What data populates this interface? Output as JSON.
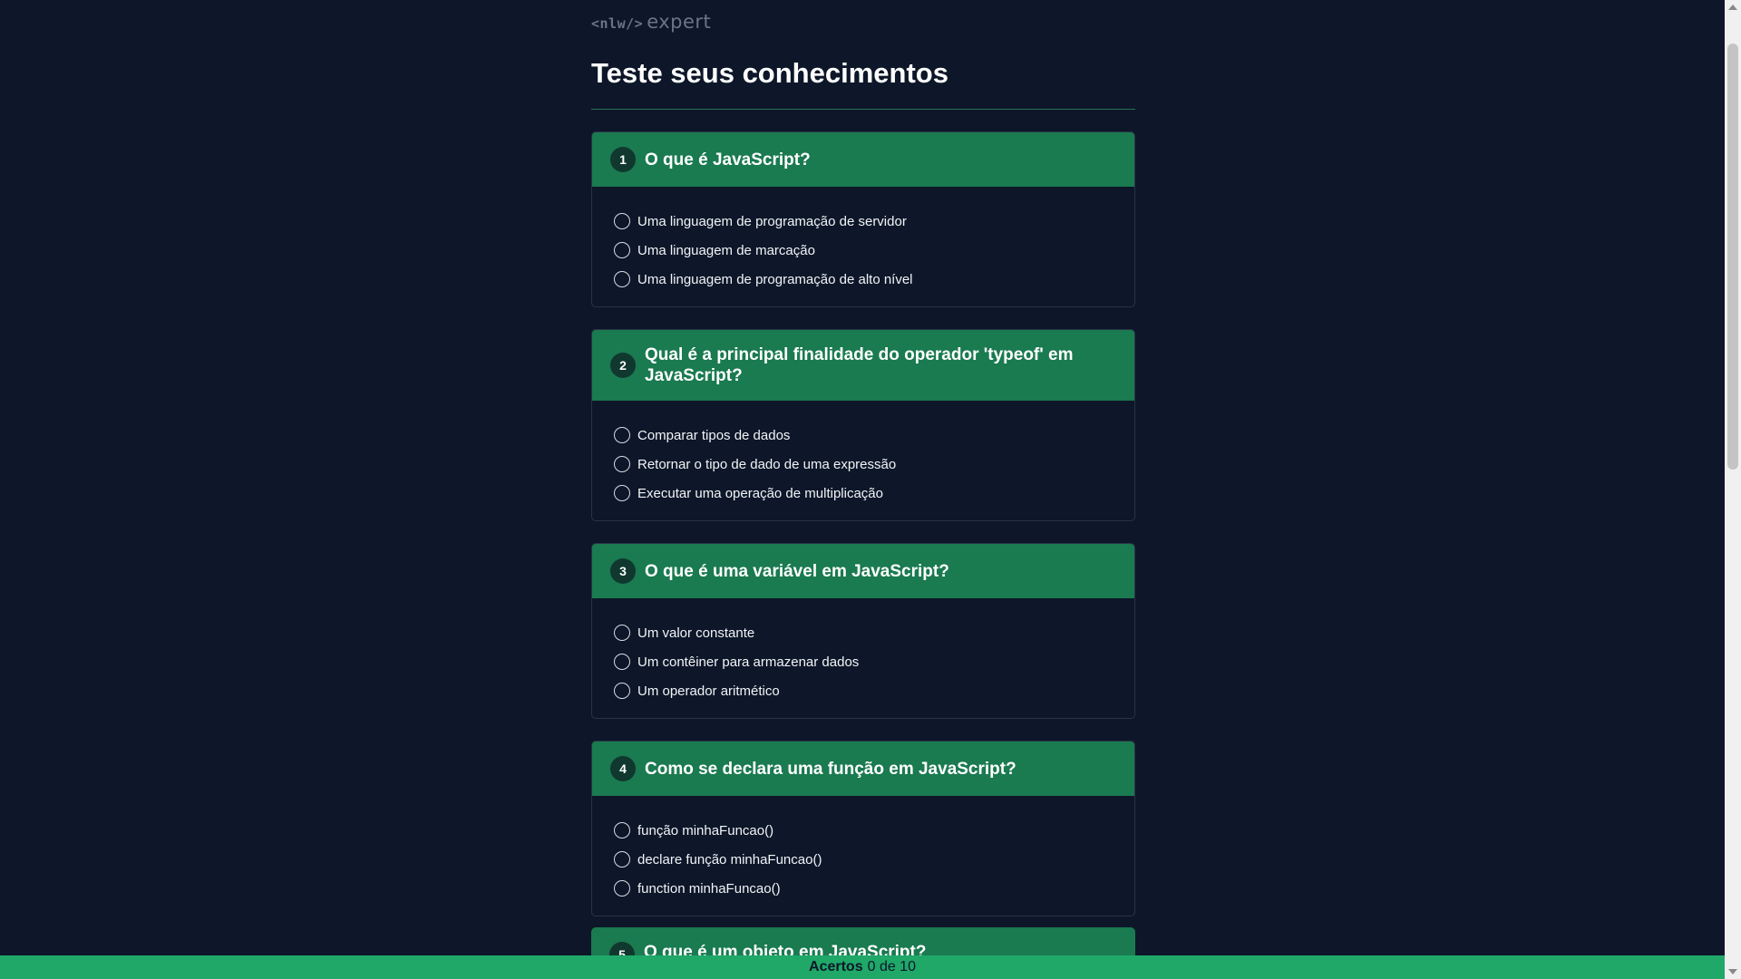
{
  "header": {
    "logo_brand": "<nlw/>",
    "logo_product": "expert",
    "title": "Teste seus conhecimentos"
  },
  "questions": [
    {
      "number": "1",
      "title": "O que é JavaScript?",
      "options": [
        "Uma linguagem de programação de servidor",
        "Uma linguagem de marcação",
        "Uma linguagem de programação de alto nível"
      ]
    },
    {
      "number": "2",
      "title": "Qual é a principal finalidade do operador 'typeof' em JavaScript?",
      "options": [
        "Comparar tipos de dados",
        "Retornar o tipo de dado de uma expressão",
        "Executar uma operação de multiplicação"
      ]
    },
    {
      "number": "3",
      "title": "O que é uma variável em JavaScript?",
      "options": [
        "Um valor constante",
        "Um contêiner para armazenar dados",
        "Um operador aritmético"
      ]
    },
    {
      "number": "4",
      "title": "Como se declara uma função em JavaScript?",
      "options": [
        "função minhaFuncao()",
        "declare função minhaFuncao()",
        "function minhaFuncao()"
      ]
    },
    {
      "number": "5",
      "title": "O que é um objeto em JavaScript?",
      "options": []
    }
  ],
  "footer": {
    "score_label": "Acertos",
    "score_value": "0 de 10"
  },
  "colors": {
    "background": "#0d1729",
    "question_header": "#1a7a50",
    "footer": "#1fa868"
  }
}
